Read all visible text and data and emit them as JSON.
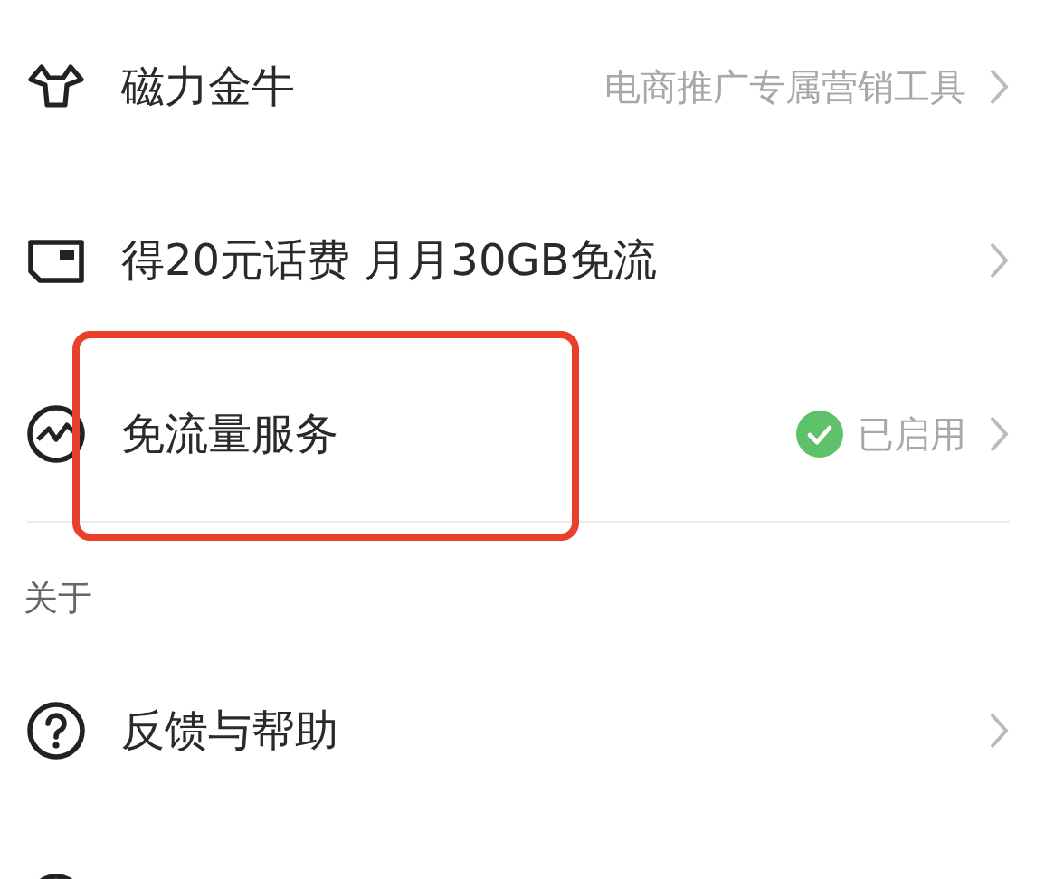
{
  "sections": [
    {
      "items": [
        {
          "title": "磁力金牛",
          "detail": "电商推广专属营销工具",
          "highlighted": false
        },
        {
          "title": "得20元话费 月月30GB免流",
          "highlighted": false
        },
        {
          "title": "免流量服务",
          "status": {
            "text": "已启用",
            "enabled": true
          },
          "highlighted": true
        }
      ]
    },
    {
      "label": "关于",
      "items": [
        {
          "title": "反馈与帮助",
          "highlighted": false
        },
        {
          "partial": true
        }
      ]
    }
  ]
}
